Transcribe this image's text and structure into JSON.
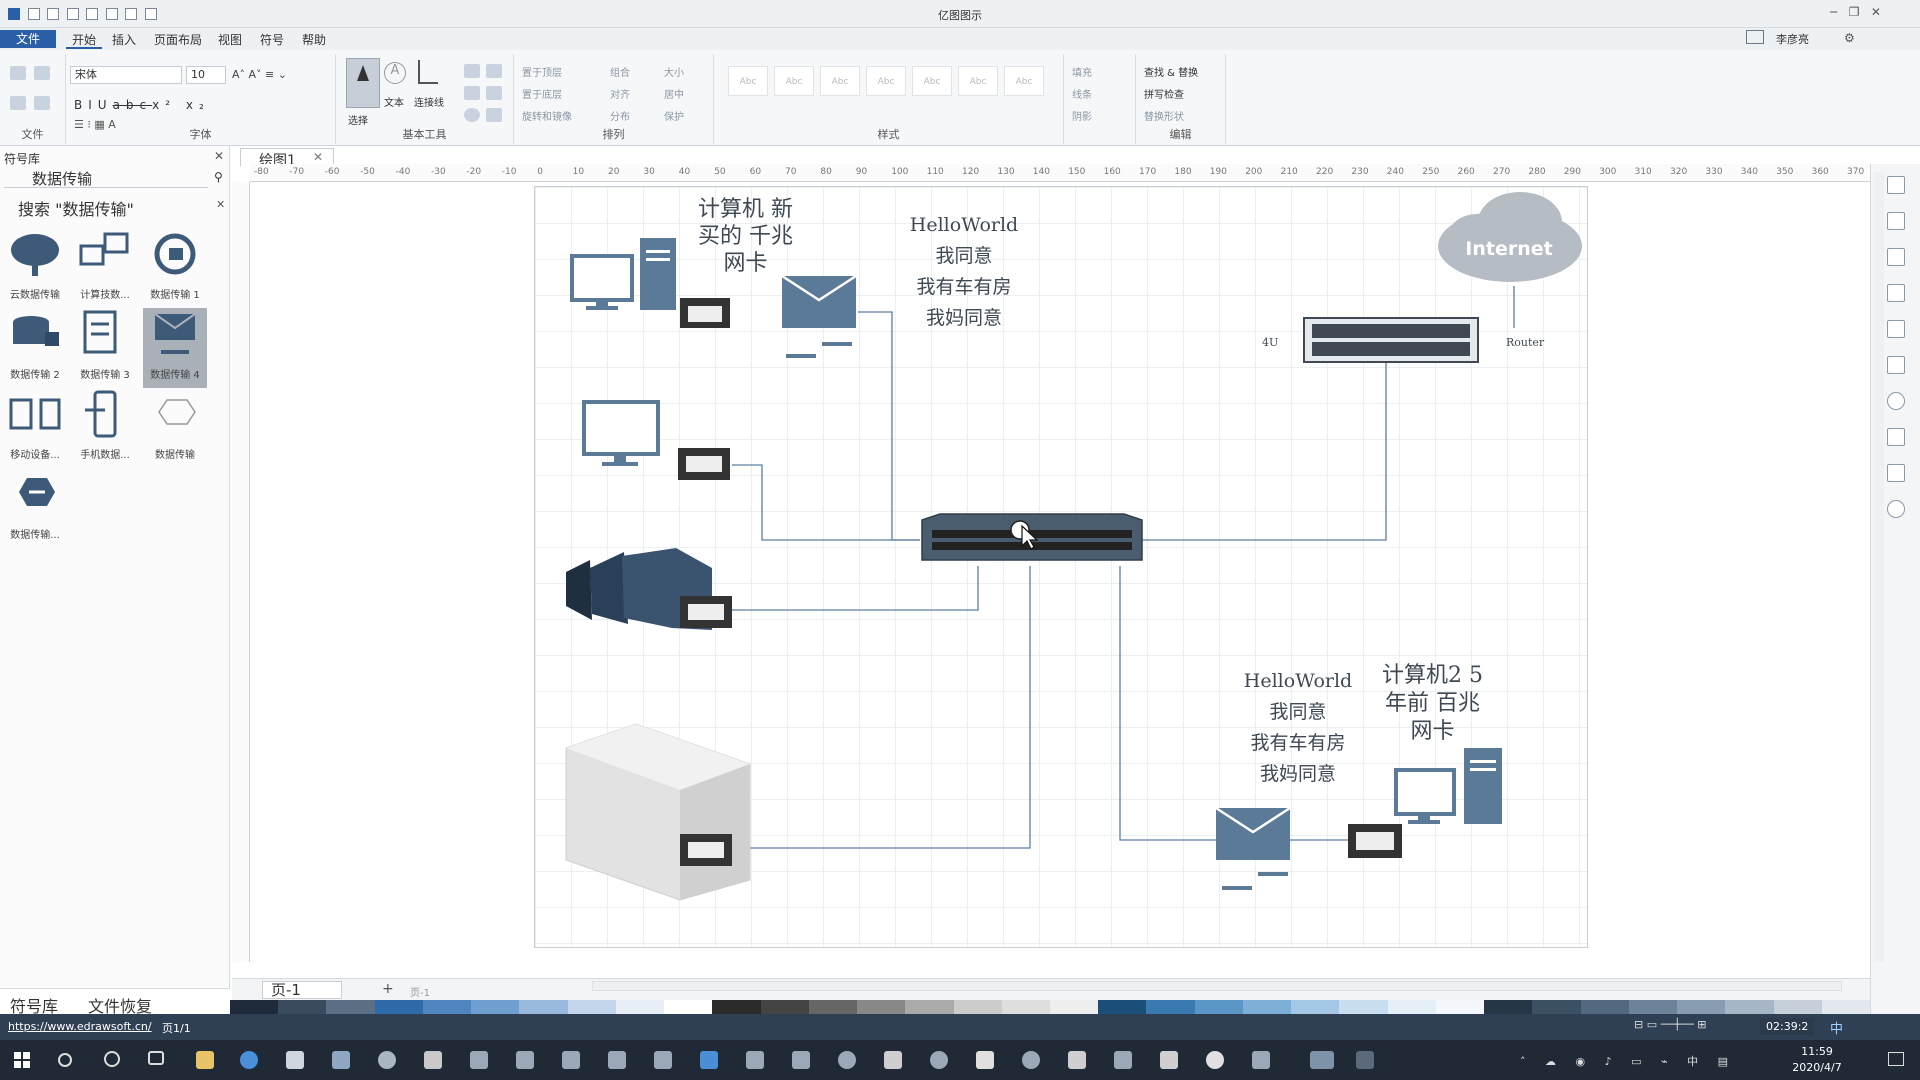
{
  "app": {
    "title": "亿图图示"
  },
  "user": {
    "name": "李彦亮"
  },
  "menu": {
    "file": "文件",
    "tabs": [
      "开始",
      "插入",
      "页面布局",
      "视图",
      "符号",
      "帮助"
    ]
  },
  "ribbon": {
    "font_name": "宋体",
    "font_size": "10",
    "groups": {
      "file": "文件",
      "font": "字体",
      "basic_tools": "基本工具",
      "arrange": "排列",
      "style": "样式",
      "edit": "编辑"
    },
    "tools": {
      "select": "选择",
      "text": "文本",
      "connector": "连接线"
    },
    "arrange_items": [
      "置于顶层",
      "置于底层",
      "旋转和镜像",
      "组合",
      "对齐",
      "分布",
      "大小",
      "居中",
      "保护"
    ],
    "fill_items": [
      "填充",
      "线条",
      "阴影"
    ],
    "edit_items": [
      "查找 & 替换",
      "拼写检查",
      "替换形状"
    ],
    "style_sample": "Abc"
  },
  "symbol_panel": {
    "title": "符号库",
    "library": "数据传输",
    "search_title": "搜索 \"数据传输\"",
    "items": [
      {
        "label": "云数据传输",
        "icon": "cloud-transfer-icon"
      },
      {
        "label": "计算技数...",
        "icon": "computer-transfer-icon"
      },
      {
        "label": "数据传输 1",
        "icon": "sync-transfer-icon"
      },
      {
        "label": "数据传输 2",
        "icon": "database-transfer-icon"
      },
      {
        "label": "数据传输 3",
        "icon": "document-transfer-icon"
      },
      {
        "label": "数据传输 4",
        "icon": "mail-transfer-icon"
      },
      {
        "label": "移动设备...",
        "icon": "mobile-device-icon"
      },
      {
        "label": "手机数据...",
        "icon": "phone-data-icon"
      },
      {
        "label": "数据传输",
        "icon": "hexagon-icon"
      },
      {
        "label": "数据传输...",
        "icon": "data-hexagon-icon"
      }
    ],
    "bottom_tabs": [
      "符号库",
      "文件恢复"
    ]
  },
  "document": {
    "tab": "绘图1",
    "page_tab": "页-1",
    "page_label": "页-1"
  },
  "ruler": {
    "h": [
      "-80",
      "-70",
      "-60",
      "-50",
      "-40",
      "-30",
      "-20",
      "-10",
      "0",
      "10",
      "20",
      "30",
      "40",
      "50",
      "60",
      "70",
      "80",
      "90",
      "100",
      "110",
      "120",
      "130",
      "140",
      "150",
      "160",
      "170",
      "180",
      "190",
      "200",
      "210",
      "220",
      "230",
      "240",
      "250",
      "260",
      "270",
      "280",
      "290",
      "300",
      "310",
      "320",
      "330",
      "340",
      "350",
      "360",
      "370"
    ]
  },
  "diagram": {
    "pc1_caption": [
      "计算机 新",
      "买的 千兆",
      "网卡"
    ],
    "pc2_caption": [
      "计算机2 5",
      "年前 百兆",
      "网卡"
    ],
    "msg1": [
      "HelloWorld",
      "我同意",
      "我有车有房",
      "我妈同意"
    ],
    "msg2": [
      "HelloWorld",
      "我同意",
      "我有车有房",
      "我妈同意"
    ],
    "internet_label": "Internet",
    "router_label": "Router",
    "rack_label": "4U"
  },
  "status": {
    "url": "https://www.edrawsoft.cn/",
    "page_info": "页1/1",
    "timer": "02:39:2",
    "ime": "中"
  },
  "taskbar": {
    "time": "11:59",
    "date": "2020/4/7"
  },
  "palette": [
    "#1f2a3a",
    "#3b4b5e",
    "#5d6f84",
    "#2e6aa7",
    "#4f86c0",
    "#6f9fd0",
    "#9ab9de",
    "#c4d6ec",
    "#e8eef6",
    "#ffffff",
    "#2b2b2b",
    "#444444",
    "#666666",
    "#888888",
    "#aaaaaa",
    "#cccccc",
    "#dddddd",
    "#eeeeee",
    "#1b4f7a",
    "#3a7ab0",
    "#5a96c8",
    "#7eafd6",
    "#a3c7e4",
    "#c9def0",
    "#e5eff8",
    "#f4f8fc",
    "#263646",
    "#3c5064",
    "#53697f",
    "#6c8399",
    "#889db2",
    "#a6b6c7",
    "#c5d0db",
    "#e3e8ee"
  ]
}
